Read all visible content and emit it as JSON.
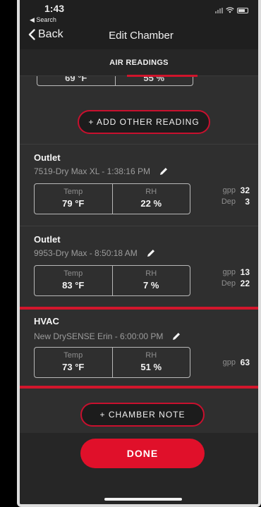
{
  "status_bar": {
    "time": "1:43",
    "back_app": "◀ Search"
  },
  "nav": {
    "back_label": "Back",
    "title": "Edit Chamber"
  },
  "tab": {
    "label": "AIR READINGS"
  },
  "partial_reading": {
    "temp": "69 °F",
    "rh": "55 %"
  },
  "add_reading_label": "+ ADD OTHER READING",
  "readings": [
    {
      "title": "Outlet",
      "subtitle": "7519-Dry Max XL - 1:38:16 PM",
      "temp_label": "Temp",
      "temp": "79 °F",
      "rh_label": "RH",
      "rh": "22 %",
      "gpp_label": "gpp",
      "gpp": "32",
      "dep_label": "Dep",
      "dep": "3"
    },
    {
      "title": "Outlet",
      "subtitle": "9953-Dry Max - 8:50:18 AM",
      "temp_label": "Temp",
      "temp": "83 °F",
      "rh_label": "RH",
      "rh": "7 %",
      "gpp_label": "gpp",
      "gpp": "13",
      "dep_label": "Dep",
      "dep": "22"
    },
    {
      "title": "HVAC",
      "subtitle": "New DrySENSE Erin - 6:00:00 PM",
      "temp_label": "Temp",
      "temp": "73 °F",
      "rh_label": "RH",
      "rh": "51 %",
      "gpp_label": "gpp",
      "gpp": "63"
    }
  ],
  "chamber_note_label": "+ CHAMBER NOTE",
  "done_label": "DONE",
  "colors": {
    "accent": "#d0142c",
    "background": "#2f2f2f"
  }
}
